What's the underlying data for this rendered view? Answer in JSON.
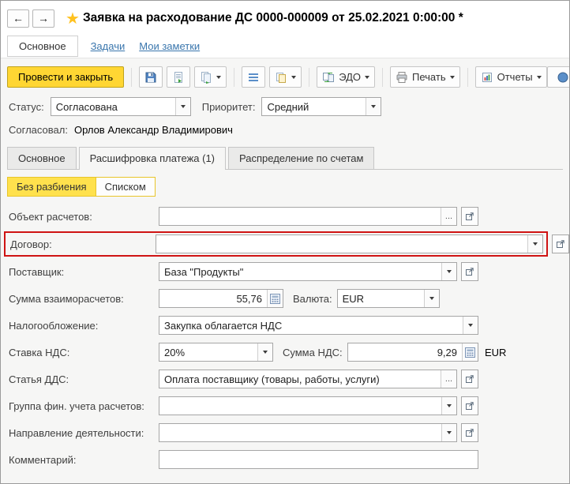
{
  "icons": {
    "back": "←",
    "forward": "→",
    "star": "★",
    "dots": "..."
  },
  "header": {
    "title": "Заявка на расходование ДС 0000-000009 от 25.02.2021 0:00:00 *"
  },
  "nav": {
    "main": "Основное",
    "tasks": "Задачи",
    "notes": "Мои заметки"
  },
  "toolbar": {
    "post_close": "Провести и закрыть",
    "edo": "ЭДО",
    "print": "Печать",
    "reports": "Отчеты"
  },
  "status": {
    "status_label": "Статус:",
    "status_value": "Согласована",
    "priority_label": "Приоритет:",
    "priority_value": "Средний",
    "approver_label": "Согласовал:",
    "approver_value": "Орлов Александр Владимирович"
  },
  "tabs": {
    "main": "Основное",
    "payment": "Расшифровка платежа (1)",
    "accounts": "Распределение по счетам"
  },
  "toggle": {
    "no_split": "Без разбиения",
    "list": "Списком"
  },
  "form": {
    "settlement_object": {
      "label": "Объект расчетов:",
      "value": ""
    },
    "contract": {
      "label": "Договор:",
      "value": ""
    },
    "supplier": {
      "label": "Поставщик:",
      "value": "База \"Продукты\""
    },
    "amount": {
      "label": "Сумма взаиморасчетов:",
      "value": "55,76"
    },
    "currency": {
      "label": "Валюта:",
      "value": "EUR"
    },
    "taxation": {
      "label": "Налогообложение:",
      "value": "Закупка облагается НДС"
    },
    "vat_rate": {
      "label": "Ставка НДС:",
      "value": "20%"
    },
    "vat_amount": {
      "label": "Сумма НДС:",
      "value": "9,29",
      "currency_suffix": "EUR"
    },
    "cash_flow_item": {
      "label": "Статья ДДС:",
      "value": "Оплата поставщику (товары, работы, услуги)"
    },
    "fin_group": {
      "label": "Группа фин. учета расчетов:",
      "value": ""
    },
    "activity": {
      "label": "Направление деятельности:",
      "value": ""
    },
    "comment": {
      "label": "Комментарий:",
      "value": ""
    }
  }
}
